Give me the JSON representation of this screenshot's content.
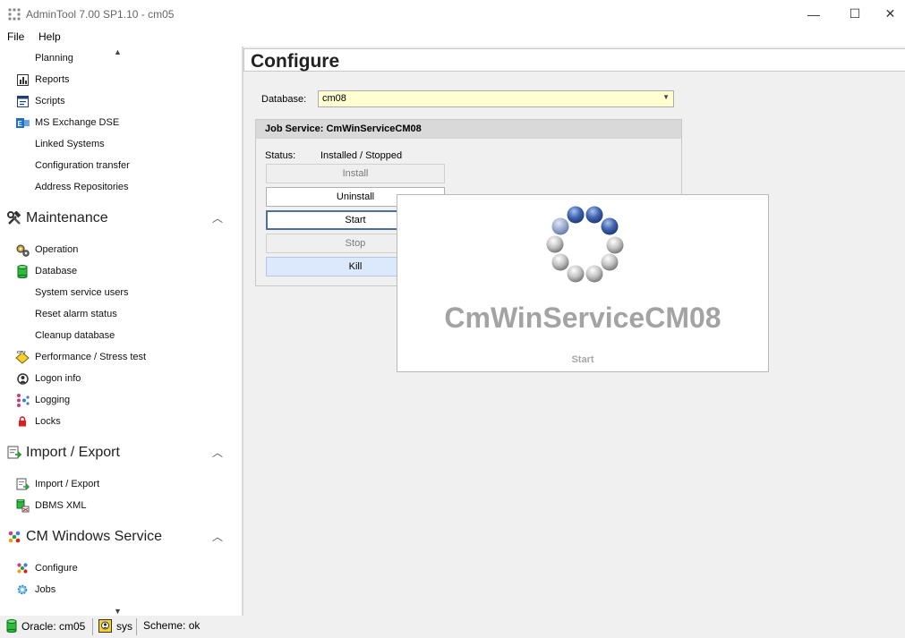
{
  "window": {
    "title": "AdminTool 7.00 SP1.10 - cm05",
    "minimize": "—",
    "maximize": "☐",
    "close": "✕"
  },
  "menu": [
    "File",
    "Help"
  ],
  "sidebar": {
    "group_tools": [
      {
        "label": "Planning",
        "icon": "planning-icon"
      },
      {
        "label": "Reports",
        "icon": "reports-icon"
      },
      {
        "label": "Scripts",
        "icon": "scripts-icon"
      },
      {
        "label": "MS Exchange DSE",
        "icon": "exchange-icon"
      },
      {
        "label": "Linked Systems",
        "icon": ""
      },
      {
        "label": "Configuration transfer",
        "icon": ""
      },
      {
        "label": "Address Repositories",
        "icon": ""
      }
    ],
    "maintenance": {
      "title": "Maintenance",
      "items": [
        {
          "label": "Operation",
          "icon": "gears-icon"
        },
        {
          "label": "Database",
          "icon": "database-icon"
        },
        {
          "label": "System service users",
          "icon": ""
        },
        {
          "label": "Reset alarm status",
          "icon": ""
        },
        {
          "label": "Cleanup database",
          "icon": ""
        },
        {
          "label": "Performance / Stress test",
          "icon": "cpu-icon"
        },
        {
          "label": "Logon info",
          "icon": "logon-icon"
        },
        {
          "label": "Logging",
          "icon": "logging-icon"
        },
        {
          "label": "Locks",
          "icon": "lock-icon"
        }
      ]
    },
    "import_export": {
      "title": "Import / Export",
      "items": [
        {
          "label": "Import / Export",
          "icon": "import-export-icon"
        },
        {
          "label": "DBMS XML",
          "icon": "dbms-xml-icon"
        }
      ]
    },
    "cm_service": {
      "title": "CM Windows Service",
      "items": [
        {
          "label": "Configure",
          "icon": "configure-icon"
        },
        {
          "label": "Jobs",
          "icon": "jobs-icon"
        }
      ]
    }
  },
  "main": {
    "title": "Configure",
    "database_label": "Database:",
    "database_value": "cm08",
    "job_panel": {
      "title": "Job Service: CmWinServiceCM08",
      "status_label": "Status:",
      "status_value": "Installed / Stopped",
      "buttons": [
        "Install",
        "Uninstall",
        "Start",
        "Stop",
        "Kill"
      ]
    }
  },
  "splash": {
    "service_name": "CmWinServiceCM08",
    "action": "Start"
  },
  "statusbar": {
    "db": "Oracle: cm05",
    "user": "sys",
    "scheme": "Scheme: ok"
  },
  "colors": {
    "accent": "#4d6f9e",
    "select_bg": "#ffffd2",
    "spinner_blue": "#3f63b0"
  }
}
